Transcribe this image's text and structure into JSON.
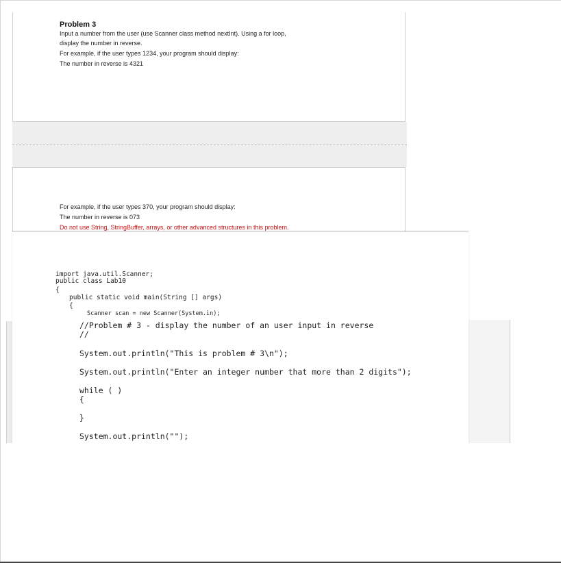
{
  "problem": {
    "title": "Problem 3",
    "lines": [
      "Input a number from the user (use Scanner class method nextInt). Using a for loop,",
      "display the number in reverse.",
      "For example, if the user types 1234, your program should display:",
      "The number in reverse is 4321"
    ],
    "continued": [
      "For example, if the user types 370, your program should display:",
      "The number in reverse is 073"
    ],
    "warning": "Do not use String, StringBuffer, arrays, or other advanced structures in this problem."
  },
  "code": {
    "l1": "import java.util.Scanner;",
    "l2": "public class Lab10",
    "l3": "{",
    "l4": "public static void main(String [] args)",
    "l5": "{",
    "l6": "Scanner scan = new Scanner(System.in);",
    "l7": "//Problem # 3 - display the number of an user input in reverse",
    "l8": "//",
    "l9": "System.out.println(\"This is problem # 3\\n\");",
    "l10": "System.out.println(\"Enter an integer number that more than 2 digits\");",
    "l11": "while ( )",
    "l12": "{",
    "l13": "}",
    "l14": "System.out.println(\"\");"
  }
}
